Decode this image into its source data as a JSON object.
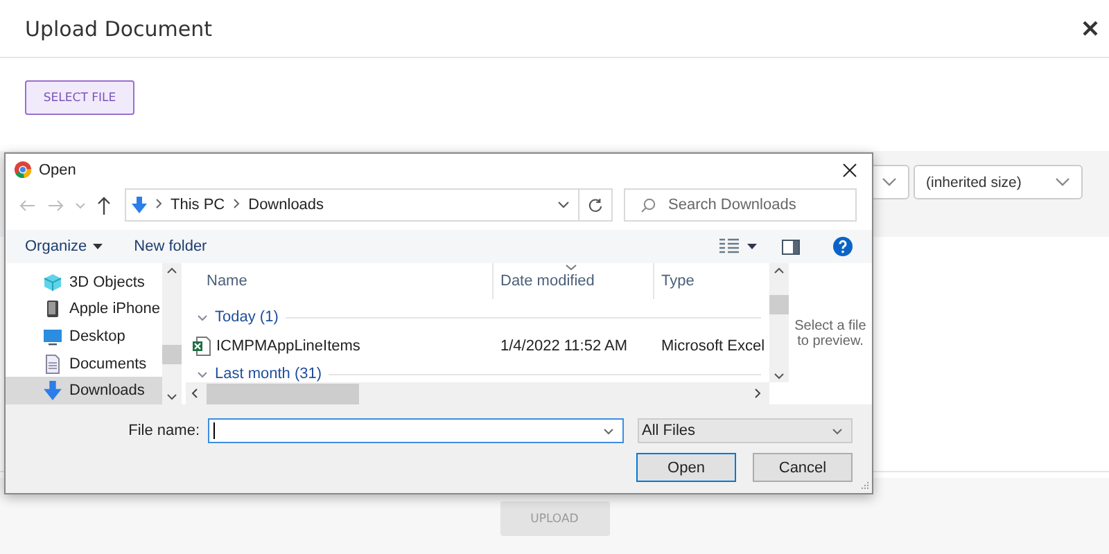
{
  "modal": {
    "title": "Upload Document",
    "select_button": "SELECT FILE",
    "size_field": {
      "value": "(inherited size)"
    },
    "upload_button": {
      "label": "UPLOAD",
      "disabled": true
    }
  },
  "dialog": {
    "title": "Open",
    "breadcrumb": [
      "This PC",
      "Downloads"
    ],
    "search": {
      "placeholder": "Search Downloads"
    },
    "toolbar": {
      "organize": "Organize",
      "new_folder": "New folder"
    },
    "nav_items": [
      {
        "label": "3D Objects",
        "kind": "cube",
        "selected": false
      },
      {
        "label": "Apple iPhone",
        "kind": "phone",
        "selected": false
      },
      {
        "label": "Desktop",
        "kind": "desktop",
        "selected": false
      },
      {
        "label": "Documents",
        "kind": "documents",
        "selected": false
      },
      {
        "label": "Downloads",
        "kind": "download",
        "selected": true
      }
    ],
    "columns": [
      {
        "label": "Name",
        "sorted": false
      },
      {
        "label": "Date modified",
        "sorted": true
      },
      {
        "label": "Type",
        "sorted": false
      }
    ],
    "groups": [
      {
        "label": "Today (1)",
        "expanded": true,
        "files": [
          {
            "name": "ICMPMAppLineItems",
            "date": "1/4/2022 11:52 AM",
            "type": "Microsoft Excel"
          }
        ]
      },
      {
        "label": "Last month (31)",
        "expanded": true
      }
    ],
    "preview": "Select a file to preview.",
    "file_name": {
      "label": "File name:"
    },
    "filter": "All Files",
    "buttons": [
      {
        "label": "Open",
        "default": true
      },
      {
        "label": "Cancel",
        "default": false
      }
    ]
  }
}
